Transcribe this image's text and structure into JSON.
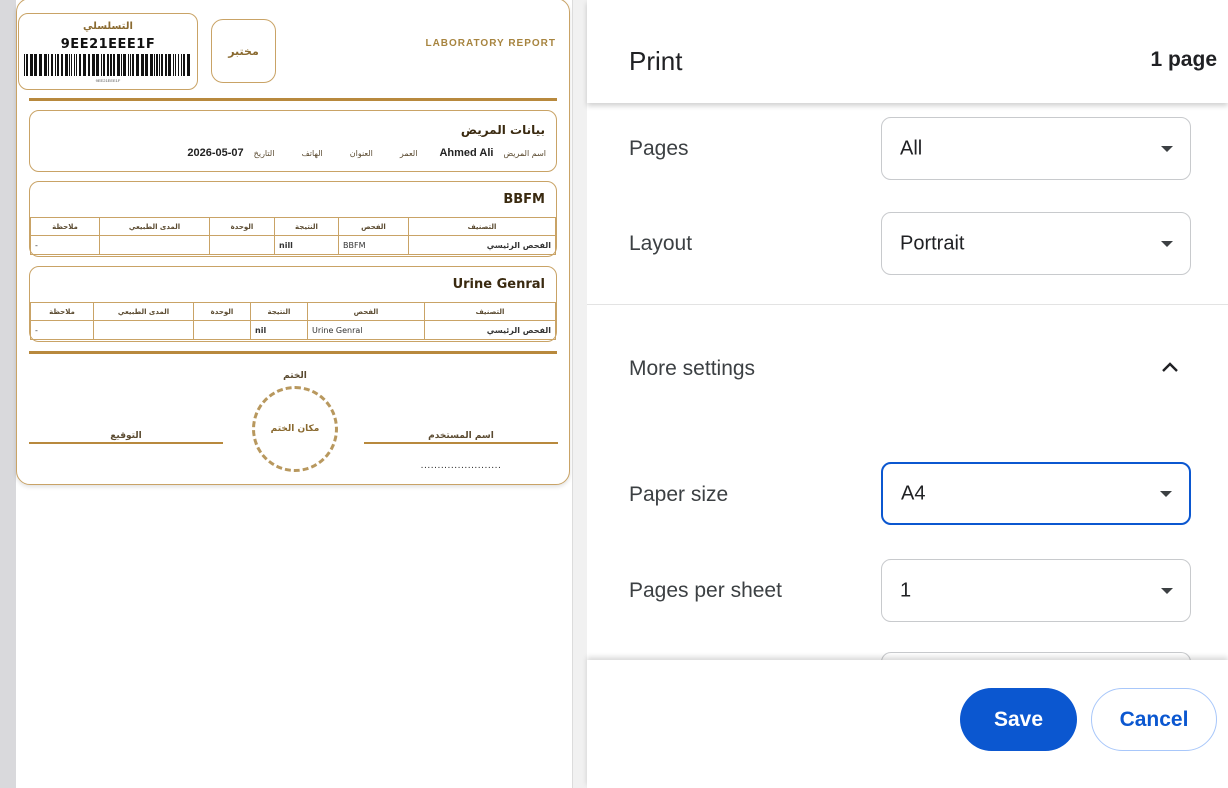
{
  "print": {
    "title": "Print",
    "page_count": "1 page",
    "settings": {
      "pages": {
        "label": "Pages",
        "value": "All"
      },
      "layout": {
        "label": "Layout",
        "value": "Portrait"
      },
      "more_settings": {
        "label": "More settings",
        "expanded": true
      },
      "paper_size": {
        "label": "Paper size",
        "value": "A4"
      },
      "pages_per_sheet": {
        "label": "Pages per sheet",
        "value": "1"
      }
    },
    "buttons": {
      "save": "Save",
      "cancel": "Cancel"
    },
    "colors": {
      "accent": "#0b57d0",
      "report_gold": "#b8893d"
    }
  },
  "report": {
    "serial_label": "التسلسلي",
    "serial_value": "9EE21EEE1F",
    "lab_label": "مختبر",
    "lab_title": "LABORATORY REPORT",
    "patient": {
      "section_title": "بيانات المريض",
      "name_label": "اسم المريض",
      "name_value": "Ahmed Ali",
      "age_label": "العمر",
      "address_label": "العنوان",
      "phone_label": "الهاتف",
      "date_label": "التاريخ",
      "date_value": "2026-05-07"
    },
    "table_headers": {
      "category": "التصنيف",
      "exam": "الفحص",
      "result": "النتيجة",
      "unit": "الوحدة",
      "range": "المدى الطبيعي",
      "note": "ملاحظة"
    },
    "tests": [
      {
        "title": "BBFM",
        "category": "الفحص الرئيسي",
        "exam": "BBFM",
        "result": "nill",
        "unit": "",
        "range": "",
        "note": "-"
      },
      {
        "title": "Urine Genral",
        "category": "الفحص الرئيسي",
        "exam": "Urine Genral",
        "result": "nil",
        "unit": "",
        "range": "",
        "note": "-"
      }
    ],
    "footer": {
      "stamp_title": "الختم",
      "stamp_placeholder": "مكان الختم",
      "signature_label": "التوقيع",
      "username_label": "اسم المستخدم",
      "username_dots": "........................"
    }
  }
}
